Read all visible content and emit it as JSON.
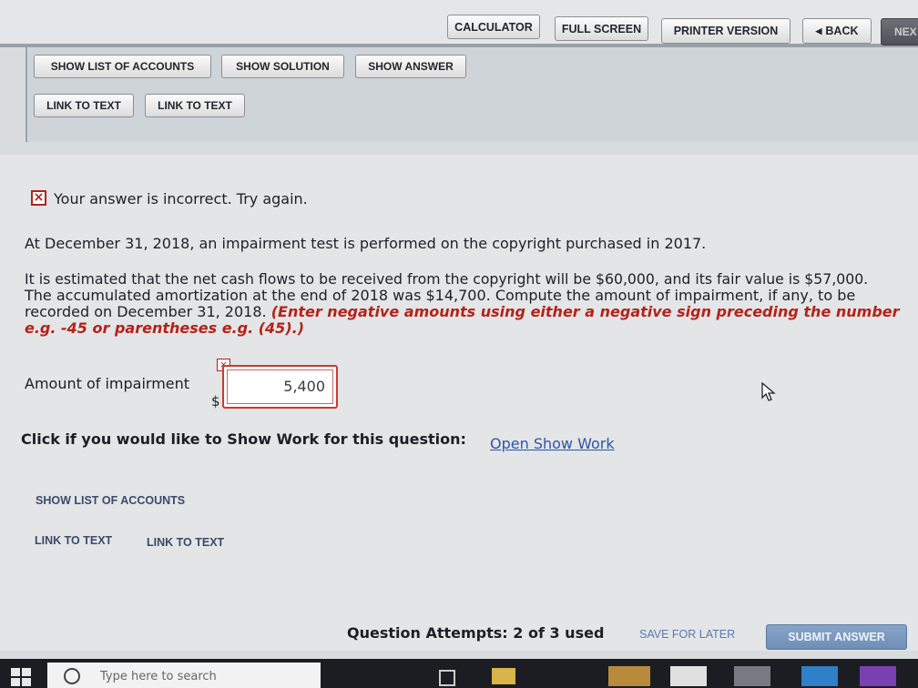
{
  "top_toolbar": {
    "calculator": "CALCULATOR",
    "full_screen": "FULL SCREEN",
    "printer_version": "PRINTER VERSION",
    "back": "BACK",
    "next": "NEX"
  },
  "panel": {
    "show_list_of_accounts": "SHOW LIST OF ACCOUNTS",
    "show_solution": "SHOW SOLUTION",
    "show_answer": "SHOW ANSWER",
    "link_to_text_1": "LINK TO TEXT",
    "link_to_text_2": "LINK TO TEXT"
  },
  "feedback": {
    "message": "Your answer is incorrect.  Try again."
  },
  "question": {
    "line1": "At December 31, 2018, an impairment test is performed on the copyright purchased in 2017.",
    "line2": "It is estimated that the net cash flows to be received from the copyright will be $60,000, and its fair value is $57,000.",
    "line3": "The accumulated amortization at the end of 2018 was $14,700. Compute the amount of impairment, if any, to be",
    "line4_plain": "recorded on December 31, 2018.",
    "line4_red": "(Enter negative amounts using either a negative sign preceding the number",
    "line5_red": "e.g. -45 or parentheses e.g. (45).)"
  },
  "answer": {
    "label": "Amount of impairment",
    "currency": "$",
    "value": "5,400"
  },
  "show_work": {
    "prompt": "Click if you would like to Show Work for this question:",
    "link": "Open Show Work"
  },
  "bottom_links": {
    "show_list_of_accounts": "SHOW LIST OF ACCOUNTS",
    "link_to_text_1": "LINK TO TEXT",
    "link_to_text_2": "LINK TO TEXT"
  },
  "footer": {
    "attempts": "Question Attempts: 2 of 3 used",
    "save_for_later": "SAVE FOR LATER",
    "submit_answer": "SUBMIT ANSWER"
  },
  "taskbar": {
    "search_placeholder": "Type here to search"
  },
  "colors": {
    "error_red": "#b3221b",
    "link_blue": "#2e56a6",
    "submit_blue": "#6f8fb8"
  }
}
